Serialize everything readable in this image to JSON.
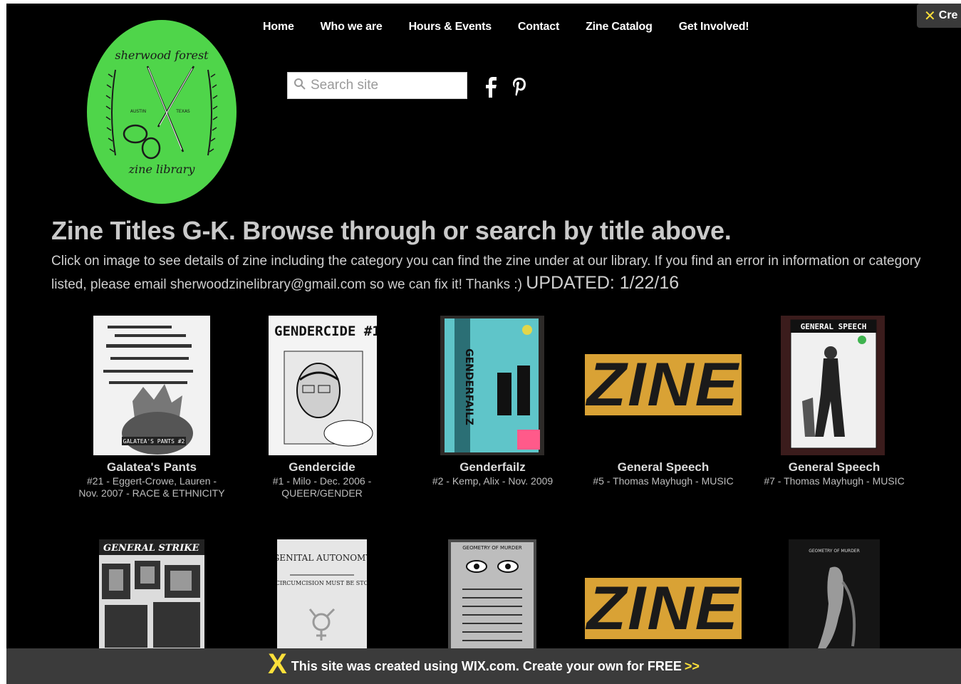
{
  "nav": {
    "items": [
      {
        "label": "Home"
      },
      {
        "label": "Who we are"
      },
      {
        "label": "Hours & Events"
      },
      {
        "label": "Contact"
      },
      {
        "label": "Zine Catalog"
      },
      {
        "label": "Get Involved!"
      }
    ]
  },
  "logo": {
    "top_text": "sherwood forest",
    "bottom_text": "zine library",
    "left_text": "AUSTIN",
    "right_text": "TEXAS",
    "color": "#4fd54a"
  },
  "search": {
    "placeholder": "Search site"
  },
  "social": {
    "facebook": "f",
    "pinterest": "p"
  },
  "wix_corner": {
    "label": "Cre"
  },
  "main": {
    "headline": "Zine Titles G-K. Browse through or search by title above.",
    "intro": "Click on image to see details of zine including the category you can find the zine under at our library. If you find an error in information or category listed, please email sherwoodzinelibrary@gmail.com so we can fix it! Thanks :)",
    "updated": "UPDATED: 1/22/16"
  },
  "zines": [
    {
      "title": "Galatea's Pants",
      "meta": "#21 - Eggert-Crowe, Lauren - Nov. 2007 - RACE & ETHNICITY",
      "cover_text": "GALATEA'S PANTS #2"
    },
    {
      "title": "Gendercide",
      "meta": "#1 - Milo - Dec. 2006 - QUEER/GENDER",
      "cover_text": "GENDERCIDE #1"
    },
    {
      "title": "Genderfailz",
      "meta": "#2 - Kemp, Alix - Nov. 2009",
      "cover_text": "GENDERFAILZ"
    },
    {
      "title": "General Speech",
      "meta": "#5 - Thomas Mayhugh - MUSIC",
      "cover_text": "ZINE"
    },
    {
      "title": "General Speech",
      "meta": "#7 - Thomas Mayhugh - MUSIC",
      "cover_text": "GENERAL SPEECH"
    },
    {
      "cover_text": "GENERAL STRIKE"
    },
    {
      "cover_text": "GENITAL AUTONOMY",
      "cover_sub": "WHY CIRCUMCISION MUST BE STOPPED"
    },
    {
      "cover_text": "GEOMETRY OF MURDER"
    },
    {
      "cover_text": "ZINE"
    },
    {
      "cover_text": "GEOMETRY OF MURDER"
    }
  ],
  "wix_bar": {
    "text": "This site was created using WIX.com. Create your own for FREE",
    "arrows": ">>",
    "accent": "#fce03a"
  }
}
